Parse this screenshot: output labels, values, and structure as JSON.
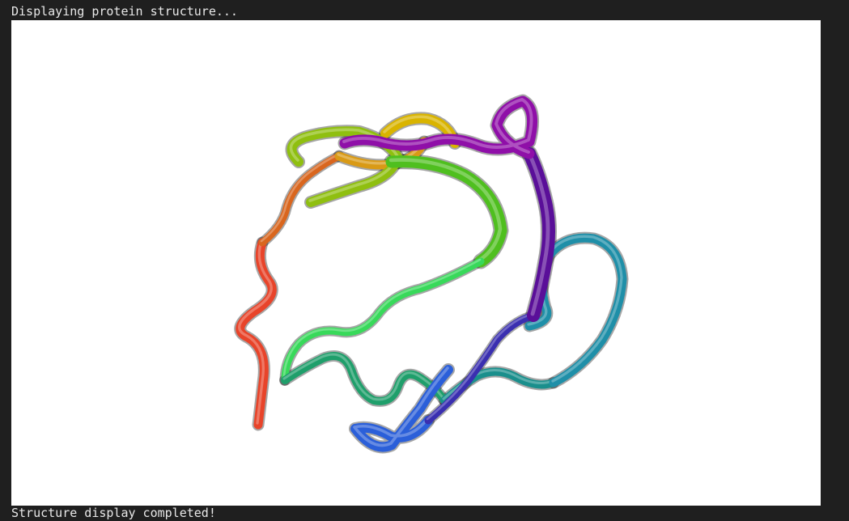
{
  "output": {
    "status_start": "Displaying protein structure...",
    "status_end": "Structure display completed!"
  },
  "viewer": {
    "background": "#ffffff",
    "representation": "cartoon",
    "coloring": "rainbow",
    "segments": [
      {
        "name": "segment-red",
        "color": "#e8442a"
      },
      {
        "name": "segment-orange",
        "color": "#d9661e"
      },
      {
        "name": "segment-yellow-orange",
        "color": "#d99a16"
      },
      {
        "name": "segment-yellow",
        "color": "#d9b400"
      },
      {
        "name": "segment-yellow-green",
        "color": "#8fbf10"
      },
      {
        "name": "segment-green",
        "color": "#4fbf1f"
      },
      {
        "name": "segment-light-green",
        "color": "#38d95a"
      },
      {
        "name": "segment-sea-green",
        "color": "#1f9f6b"
      },
      {
        "name": "segment-teal",
        "color": "#1a8f8c"
      },
      {
        "name": "segment-cyan",
        "color": "#1f8fa8"
      },
      {
        "name": "segment-blue",
        "color": "#2b5fd9"
      },
      {
        "name": "segment-indigo",
        "color": "#3a2fb0"
      },
      {
        "name": "segment-purple",
        "color": "#5a0f99"
      },
      {
        "name": "segment-magenta",
        "color": "#8f0fa8"
      }
    ]
  }
}
